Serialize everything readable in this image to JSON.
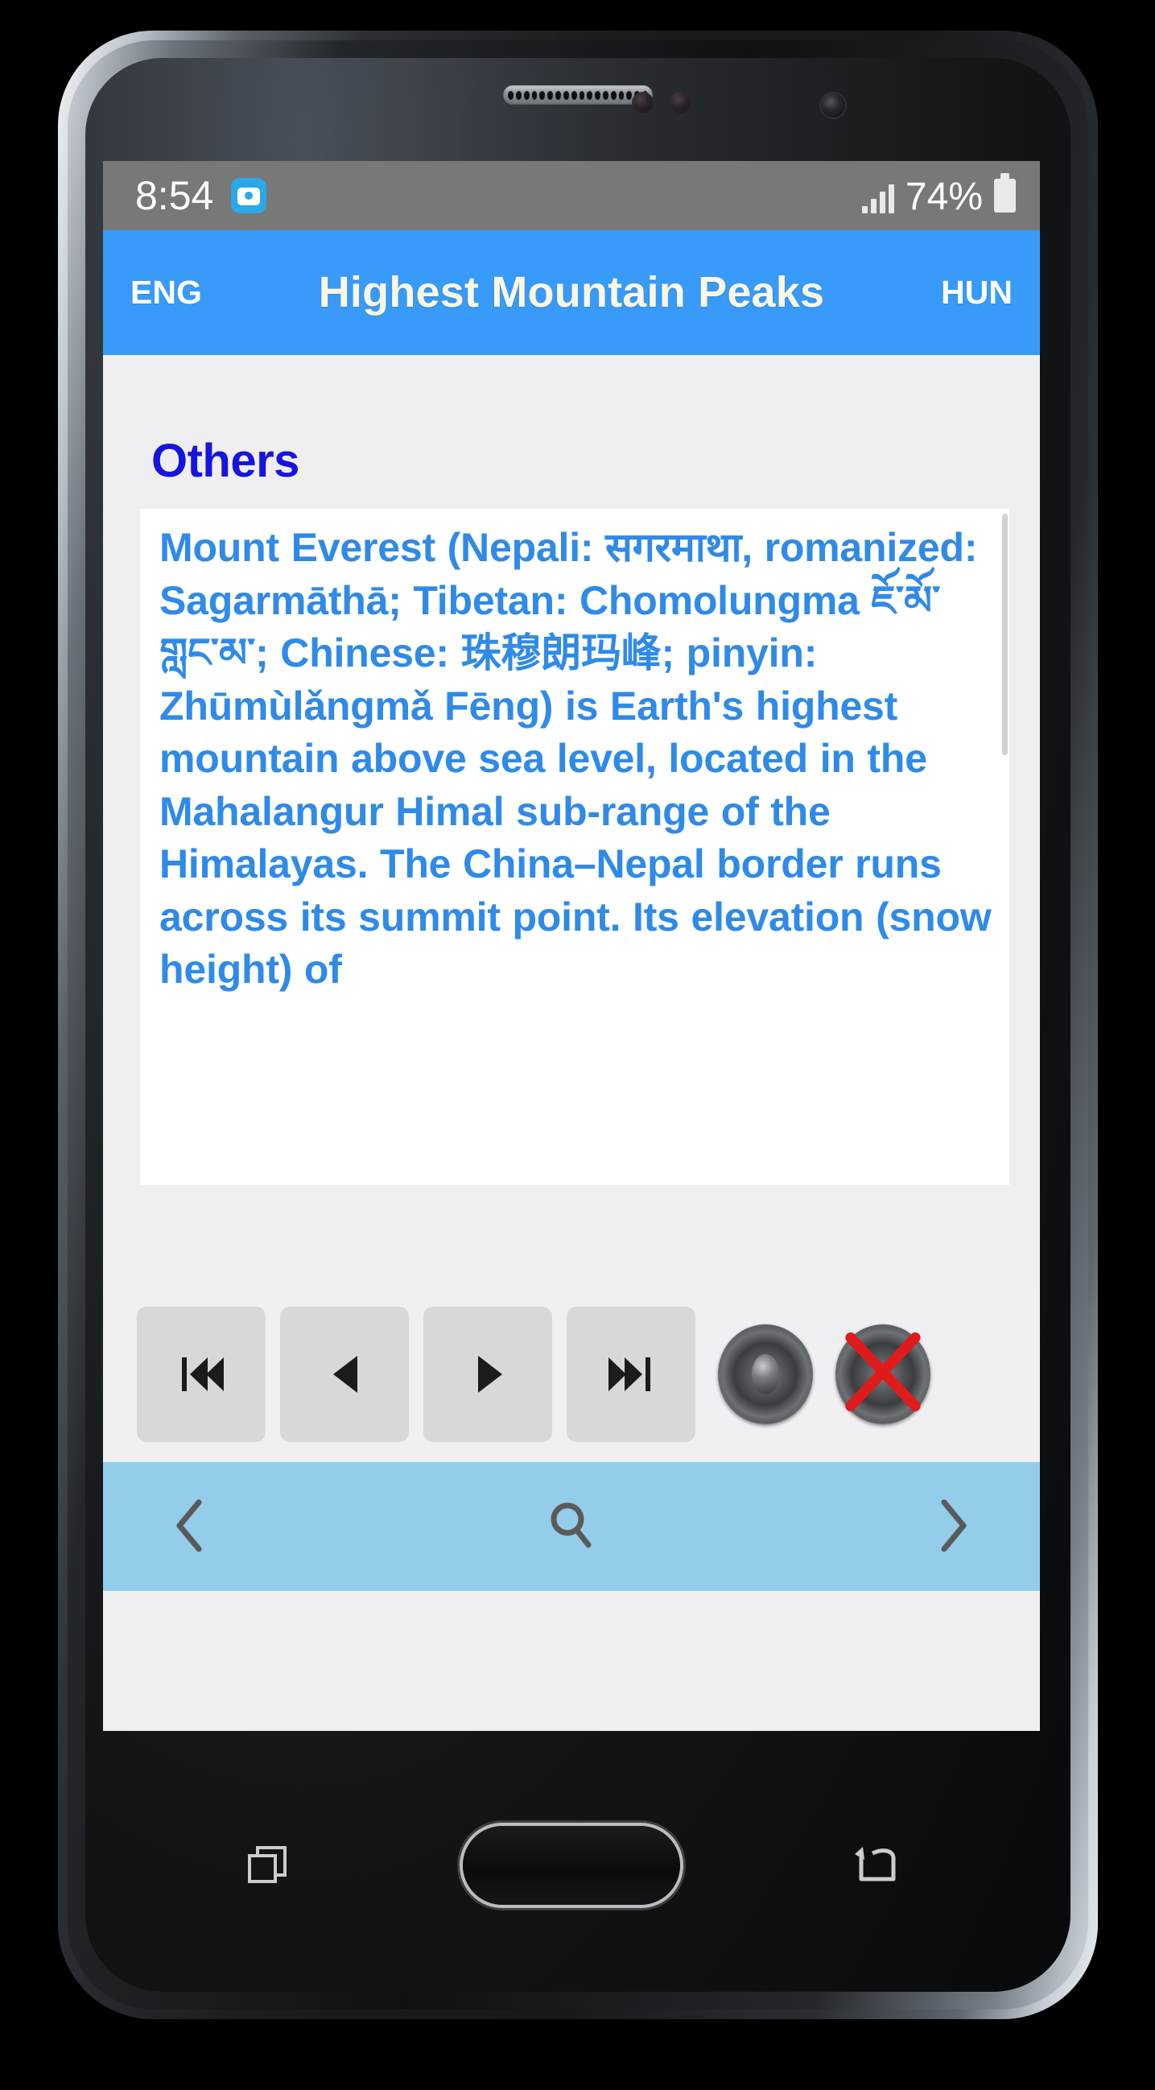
{
  "status_bar": {
    "time": "8:54",
    "battery_percent": "74%",
    "screenshot_icon": "camera-icon",
    "signal_icon": "signal-bars-icon",
    "battery_icon": "battery-icon"
  },
  "app_bar": {
    "left_language": "ENG",
    "title": "Highest Mountain Peaks",
    "right_language": "HUN",
    "background_color": "#389af9",
    "title_color": "#faf7e4"
  },
  "content": {
    "section_heading": "Others",
    "section_heading_color": "#1713e0",
    "article_text": "Mount Everest (Nepali: सगरमाथा, romanized: Sagarmāthā; Tibetan: Chomolungma ཇོ་མོ་གླང་མ་; Chinese: 珠穆朗玛峰; pinyin: Zhūmùlǎngmǎ Fēng) is Earth's highest mountain above sea level, located in the Mahalangur Himal sub-range of the Himalayas. The China–Nepal border runs across its summit point. Its elevation (snow height) of",
    "article_text_color": "#2f8ae8",
    "card_background": "#ffffff"
  },
  "media_controls": {
    "buttons": [
      {
        "name": "skip-to-start-button",
        "icon": "skip-backward-icon",
        "label": "First"
      },
      {
        "name": "previous-button",
        "icon": "previous-triangle-icon",
        "label": "Previous"
      },
      {
        "name": "play-button",
        "icon": "play-triangle-icon",
        "label": "Play"
      },
      {
        "name": "skip-to-end-button",
        "icon": "skip-forward-icon",
        "label": "Next"
      }
    ],
    "speaker_button": {
      "name": "speaker-button",
      "icon": "speaker-icon",
      "label": "Speak"
    },
    "mute_button": {
      "name": "mute-button",
      "icon": "speaker-mute-icon",
      "label": "Stop"
    },
    "background_color": "#f0f0f2",
    "button_color": "#d8d8d8"
  },
  "bottom_bar": {
    "back_label": "‹",
    "search_icon": "search-icon",
    "forward_label": "›",
    "background_color": "#93cdea",
    "icon_color": "#5a5a5a"
  },
  "system_nav": {
    "recents_icon": "recents-icon",
    "home_button": "home-button",
    "back_icon": "back-arrow-icon"
  }
}
